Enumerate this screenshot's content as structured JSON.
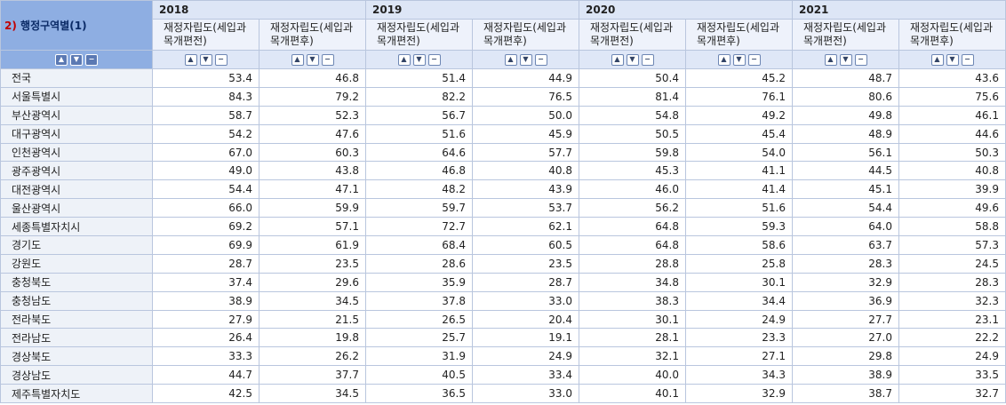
{
  "table": {
    "corner_number": "2)",
    "corner_label": "행정구역별(1)",
    "years": [
      "2018",
      "2019",
      "2020",
      "2021"
    ],
    "subheaders": [
      "재정자립도(세입과목개편전)",
      "재정자립도(세입과목개편후)"
    ],
    "controls": {
      "up": "▲",
      "down": "▼",
      "remove": "−"
    },
    "rows": [
      {
        "region": "전국",
        "values": [
          "53.4",
          "46.8",
          "51.4",
          "44.9",
          "50.4",
          "45.2",
          "48.7",
          "43.6"
        ]
      },
      {
        "region": "서울특별시",
        "values": [
          "84.3",
          "79.2",
          "82.2",
          "76.5",
          "81.4",
          "76.1",
          "80.6",
          "75.6"
        ]
      },
      {
        "region": "부산광역시",
        "values": [
          "58.7",
          "52.3",
          "56.7",
          "50.0",
          "54.8",
          "49.2",
          "49.8",
          "46.1"
        ]
      },
      {
        "region": "대구광역시",
        "values": [
          "54.2",
          "47.6",
          "51.6",
          "45.9",
          "50.5",
          "45.4",
          "48.9",
          "44.6"
        ]
      },
      {
        "region": "인천광역시",
        "values": [
          "67.0",
          "60.3",
          "64.6",
          "57.7",
          "59.8",
          "54.0",
          "56.1",
          "50.3"
        ]
      },
      {
        "region": "광주광역시",
        "values": [
          "49.0",
          "43.8",
          "46.8",
          "40.8",
          "45.3",
          "41.1",
          "44.5",
          "40.8"
        ]
      },
      {
        "region": "대전광역시",
        "values": [
          "54.4",
          "47.1",
          "48.2",
          "43.9",
          "46.0",
          "41.4",
          "45.1",
          "39.9"
        ]
      },
      {
        "region": "울산광역시",
        "values": [
          "66.0",
          "59.9",
          "59.7",
          "53.7",
          "56.2",
          "51.6",
          "54.4",
          "49.6"
        ]
      },
      {
        "region": "세종특별자치시",
        "values": [
          "69.2",
          "57.1",
          "72.7",
          "62.1",
          "64.8",
          "59.3",
          "64.0",
          "58.8"
        ]
      },
      {
        "region": "경기도",
        "values": [
          "69.9",
          "61.9",
          "68.4",
          "60.5",
          "64.8",
          "58.6",
          "63.7",
          "57.3"
        ]
      },
      {
        "region": "강원도",
        "values": [
          "28.7",
          "23.5",
          "28.6",
          "23.5",
          "28.8",
          "25.8",
          "28.3",
          "24.5"
        ]
      },
      {
        "region": "충청북도",
        "values": [
          "37.4",
          "29.6",
          "35.9",
          "28.7",
          "34.8",
          "30.1",
          "32.9",
          "28.3"
        ]
      },
      {
        "region": "충청남도",
        "values": [
          "38.9",
          "34.5",
          "37.8",
          "33.0",
          "38.3",
          "34.4",
          "36.9",
          "32.3"
        ]
      },
      {
        "region": "전라북도",
        "values": [
          "27.9",
          "21.5",
          "26.5",
          "20.4",
          "30.1",
          "24.9",
          "27.7",
          "23.1"
        ]
      },
      {
        "region": "전라남도",
        "values": [
          "26.4",
          "19.8",
          "25.7",
          "19.1",
          "28.1",
          "23.3",
          "27.0",
          "22.2"
        ]
      },
      {
        "region": "경상북도",
        "values": [
          "33.3",
          "26.2",
          "31.9",
          "24.9",
          "32.1",
          "27.1",
          "29.8",
          "24.9"
        ]
      },
      {
        "region": "경상남도",
        "values": [
          "44.7",
          "37.7",
          "40.5",
          "33.4",
          "40.0",
          "34.3",
          "38.9",
          "33.5"
        ]
      },
      {
        "region": "제주특별자치도",
        "values": [
          "42.5",
          "34.5",
          "36.5",
          "33.0",
          "40.1",
          "32.9",
          "38.7",
          "32.7"
        ]
      }
    ]
  }
}
